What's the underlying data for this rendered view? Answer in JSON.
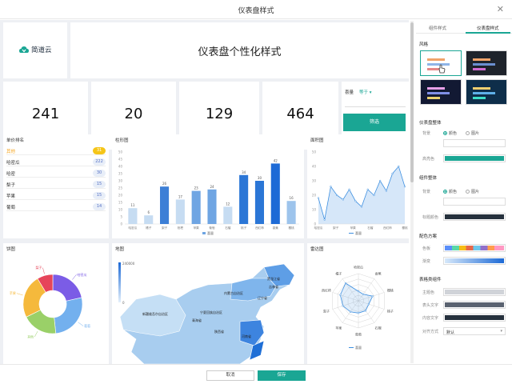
{
  "dialog": {
    "title": "仪表盘样式",
    "close_glyph": "✕"
  },
  "header": {
    "logo_text": "简道云",
    "title": "仪表盘个性化样式"
  },
  "kpis": [
    "241",
    "20",
    "129",
    "464"
  ],
  "filter": {
    "label": "喜量",
    "select": "等于 ▾",
    "button": "筛选"
  },
  "ranking": {
    "title": "单价排名",
    "rows": [
      {
        "name": "其他",
        "value": "31"
      },
      {
        "name": "哈密瓜",
        "value": "222"
      },
      {
        "name": "哈密",
        "value": "30"
      },
      {
        "name": "梨子",
        "value": "15"
      },
      {
        "name": "苹果",
        "value": "15"
      },
      {
        "name": "葡萄",
        "value": "14"
      }
    ]
  },
  "charts": {
    "bar_title": "柱形图",
    "area_title": "面积图",
    "pie_title": "饼图",
    "map_title": "地图",
    "radar_title": "雷达图"
  },
  "chart_data": [
    {
      "type": "bar",
      "title": "柱形图",
      "categories": [
        "哈密瓜",
        "橘子",
        "梨子",
        "枇杷",
        "苹果",
        "葡萄",
        "石榴",
        "桃子",
        "西红柿",
        "香蕉",
        "樱桃"
      ],
      "values": [
        11,
        6,
        26,
        17,
        23,
        24,
        12,
        34,
        30,
        42,
        16
      ],
      "ylim": [
        0,
        50
      ],
      "yticks": [
        0,
        5,
        10,
        15,
        20,
        25,
        30,
        35,
        40,
        45,
        50
      ],
      "legend": "喜量",
      "colors": [
        "#c6dcf2",
        "#c6dcf2",
        "#3d7fd6",
        "#c6dcf2",
        "#6fa5e3",
        "#6fa5e3",
        "#c6dcf2",
        "#2b76d6",
        "#2b76d6",
        "#1d6ad6",
        "#9dc4ec"
      ]
    },
    {
      "type": "area",
      "title": "面积图",
      "categories": [
        "哈密瓜",
        "梨子",
        "苹果",
        "石榴",
        "西红柿",
        "樱桃"
      ],
      "values": [
        18,
        3,
        26,
        20,
        17,
        24,
        16,
        12,
        24,
        20,
        30,
        23,
        35,
        40,
        26
      ],
      "ylim": [
        0,
        50
      ],
      "yticks": [
        0,
        10,
        20,
        30,
        40,
        50
      ],
      "legend": "喜量",
      "color": "#3d8fe0"
    },
    {
      "type": "pie",
      "title": "饼图",
      "labels": [
        "哈密瓜",
        "葡萄",
        "其他",
        "苹果",
        "梨子"
      ],
      "values": [
        20,
        25,
        18,
        22,
        8
      ],
      "colors": [
        "#7b5ce6",
        "#73b0ee",
        "#9ad068",
        "#f5b93c",
        "#e6455a"
      ]
    },
    {
      "type": "map",
      "title": "地图",
      "legend_max": "240000",
      "legend_min": "0",
      "labels": [
        "黑龙江省",
        "吉林省",
        "内蒙古自治区",
        "辽宁省",
        "新疆维吾尔自治区",
        "宁夏回族自治区",
        "青海省",
        "陕西省",
        "河南省"
      ]
    },
    {
      "type": "radar",
      "title": "雷达图",
      "indicators": [
        "哈密瓜",
        "香蕉",
        "樱桃",
        "桃子",
        "石榴",
        "葡萄",
        "苹果",
        "梨子",
        "西红柿",
        "橘子"
      ],
      "values": [
        0.35,
        0.3,
        0.55,
        0.4,
        0.45,
        0.45,
        0.5,
        0.6,
        0.7,
        0.8
      ],
      "legend": "喜量"
    }
  ],
  "panel": {
    "tab1": "组件样式",
    "tab2": "仪表盘样式",
    "style_label": "风格",
    "dash_overall": "仪表盘整体",
    "bg_label": "背景",
    "color_opt": "颜色",
    "image_opt": "图片",
    "highlight_label": "高亮色",
    "comp_overall": "组件整体",
    "title_color_label": "标题颜色",
    "palette_section": "配色方案",
    "palette_label": "色板",
    "gradient_label": "渐变",
    "table_section": "表格类组件",
    "theme_label": "主题色",
    "header_text_label": "表头文字",
    "content_text_label": "内容文字",
    "align_label": "对齐方式",
    "align_value": "默认",
    "colors": {
      "accent": "#1aa694",
      "bg_dark": "#26313d"
    }
  },
  "footer": {
    "cancel": "取消",
    "save": "保存"
  }
}
